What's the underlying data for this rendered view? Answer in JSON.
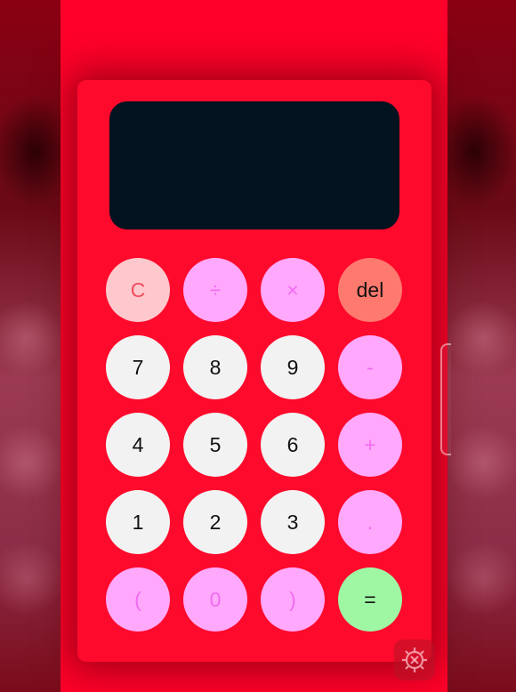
{
  "display": {
    "value": ""
  },
  "keys": {
    "clear": "C",
    "divide": "÷",
    "multiply": "×",
    "delete": "del",
    "seven": "7",
    "eight": "8",
    "nine": "9",
    "minus": "-",
    "four": "4",
    "five": "5",
    "six": "6",
    "plus": "+",
    "one": "1",
    "two": "2",
    "three": "3",
    "decimal": ".",
    "open_paren": "(",
    "zero": "0",
    "close_paren": ")",
    "equals": "="
  },
  "colors": {
    "screen_background": "#fe0029",
    "display_background": "#02121f",
    "number_key": "#f2f2f2",
    "operator_key": "#ffa8fc",
    "operator_text": "#f06bf0",
    "clear_key": "#ffc8cc",
    "delete_key": "#ff7a6e",
    "equals_key": "#9ff7a4"
  },
  "icons": {
    "floating_button": "settings-gear-icon"
  }
}
